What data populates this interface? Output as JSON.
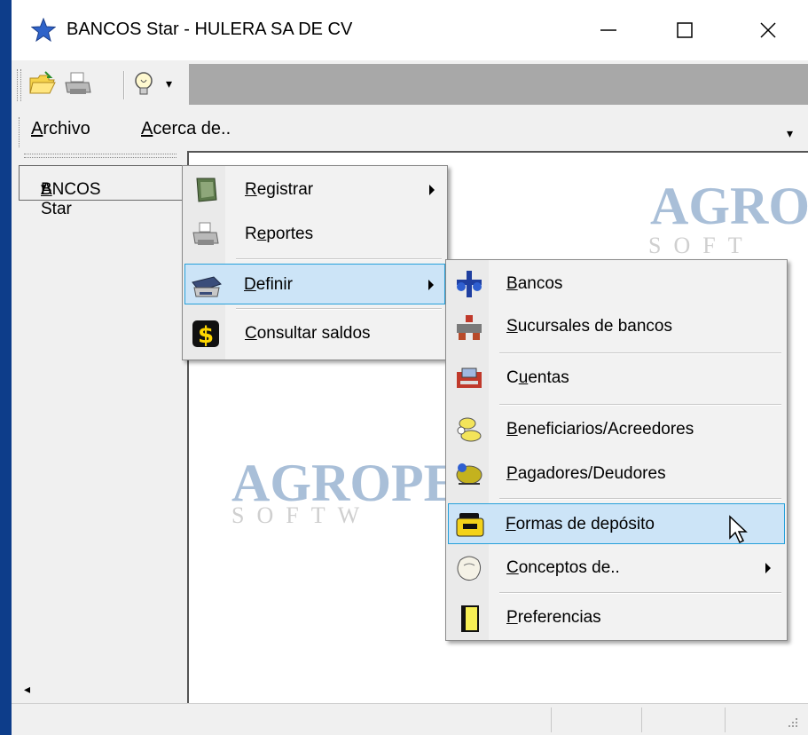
{
  "window": {
    "title": "BANCOS Star - HULERA SA DE CV"
  },
  "titlebar": {
    "minimize": "—",
    "maximize": "☐",
    "close": "✕"
  },
  "toolbar": {
    "open_icon": "folder-open-icon",
    "print_icon": "printer-icon",
    "tip_icon": "lightbulb-icon",
    "dropdown": "▾"
  },
  "menubar": {
    "archivo_u": "A",
    "archivo_rest": "rchivo",
    "acerca_u": "A",
    "acerca_rest": "cerca de..",
    "overflow": "▾"
  },
  "left": {
    "bancos_btn_u": "B",
    "bancos_btn_rest": "ANCOS Star",
    "bancos_btn_arrow": "▾",
    "scroll_arrow": "◂"
  },
  "logo": {
    "text_top": "AGRO",
    "sub_top": "SOFT",
    "text_mid": "AGROPE",
    "sub_mid": "SOFTW"
  },
  "menu1": {
    "items": [
      {
        "pre": "",
        "u": "R",
        "post": "egistrar",
        "submenu": true,
        "icon": "register-icon"
      },
      {
        "pre": "R",
        "u": "e",
        "post": "portes",
        "submenu": false,
        "icon": "printer-icon"
      },
      {
        "pre": "",
        "u": "D",
        "post": "efinir",
        "submenu": true,
        "icon": "scanner-icon"
      },
      {
        "pre": "",
        "u": "C",
        "post": "onsultar saldos",
        "submenu": false,
        "icon": "dollar-icon"
      }
    ]
  },
  "menu2": {
    "items": [
      {
        "pre": "",
        "u": "B",
        "post": "ancos",
        "icon": "bank-icon"
      },
      {
        "pre": "",
        "u": "S",
        "post": "ucursales de bancos",
        "icon": "branch-icon"
      },
      {
        "pre": "C",
        "u": "u",
        "post": "entas",
        "icon": "account-icon"
      },
      {
        "pre": "",
        "u": "B",
        "post": "eneficiarios/Acreedores",
        "icon": "beneficiary-icon"
      },
      {
        "pre": "",
        "u": "P",
        "post": "agadores/Deudores",
        "icon": "payer-icon"
      },
      {
        "pre": "",
        "u": "F",
        "post": "ormas de depósito",
        "icon": "deposit-icon"
      },
      {
        "pre": "",
        "u": "C",
        "post": "onceptos de..",
        "icon": "concepts-icon"
      },
      {
        "pre": "",
        "u": "P",
        "post": "referencias",
        "icon": "preferences-icon"
      }
    ]
  }
}
